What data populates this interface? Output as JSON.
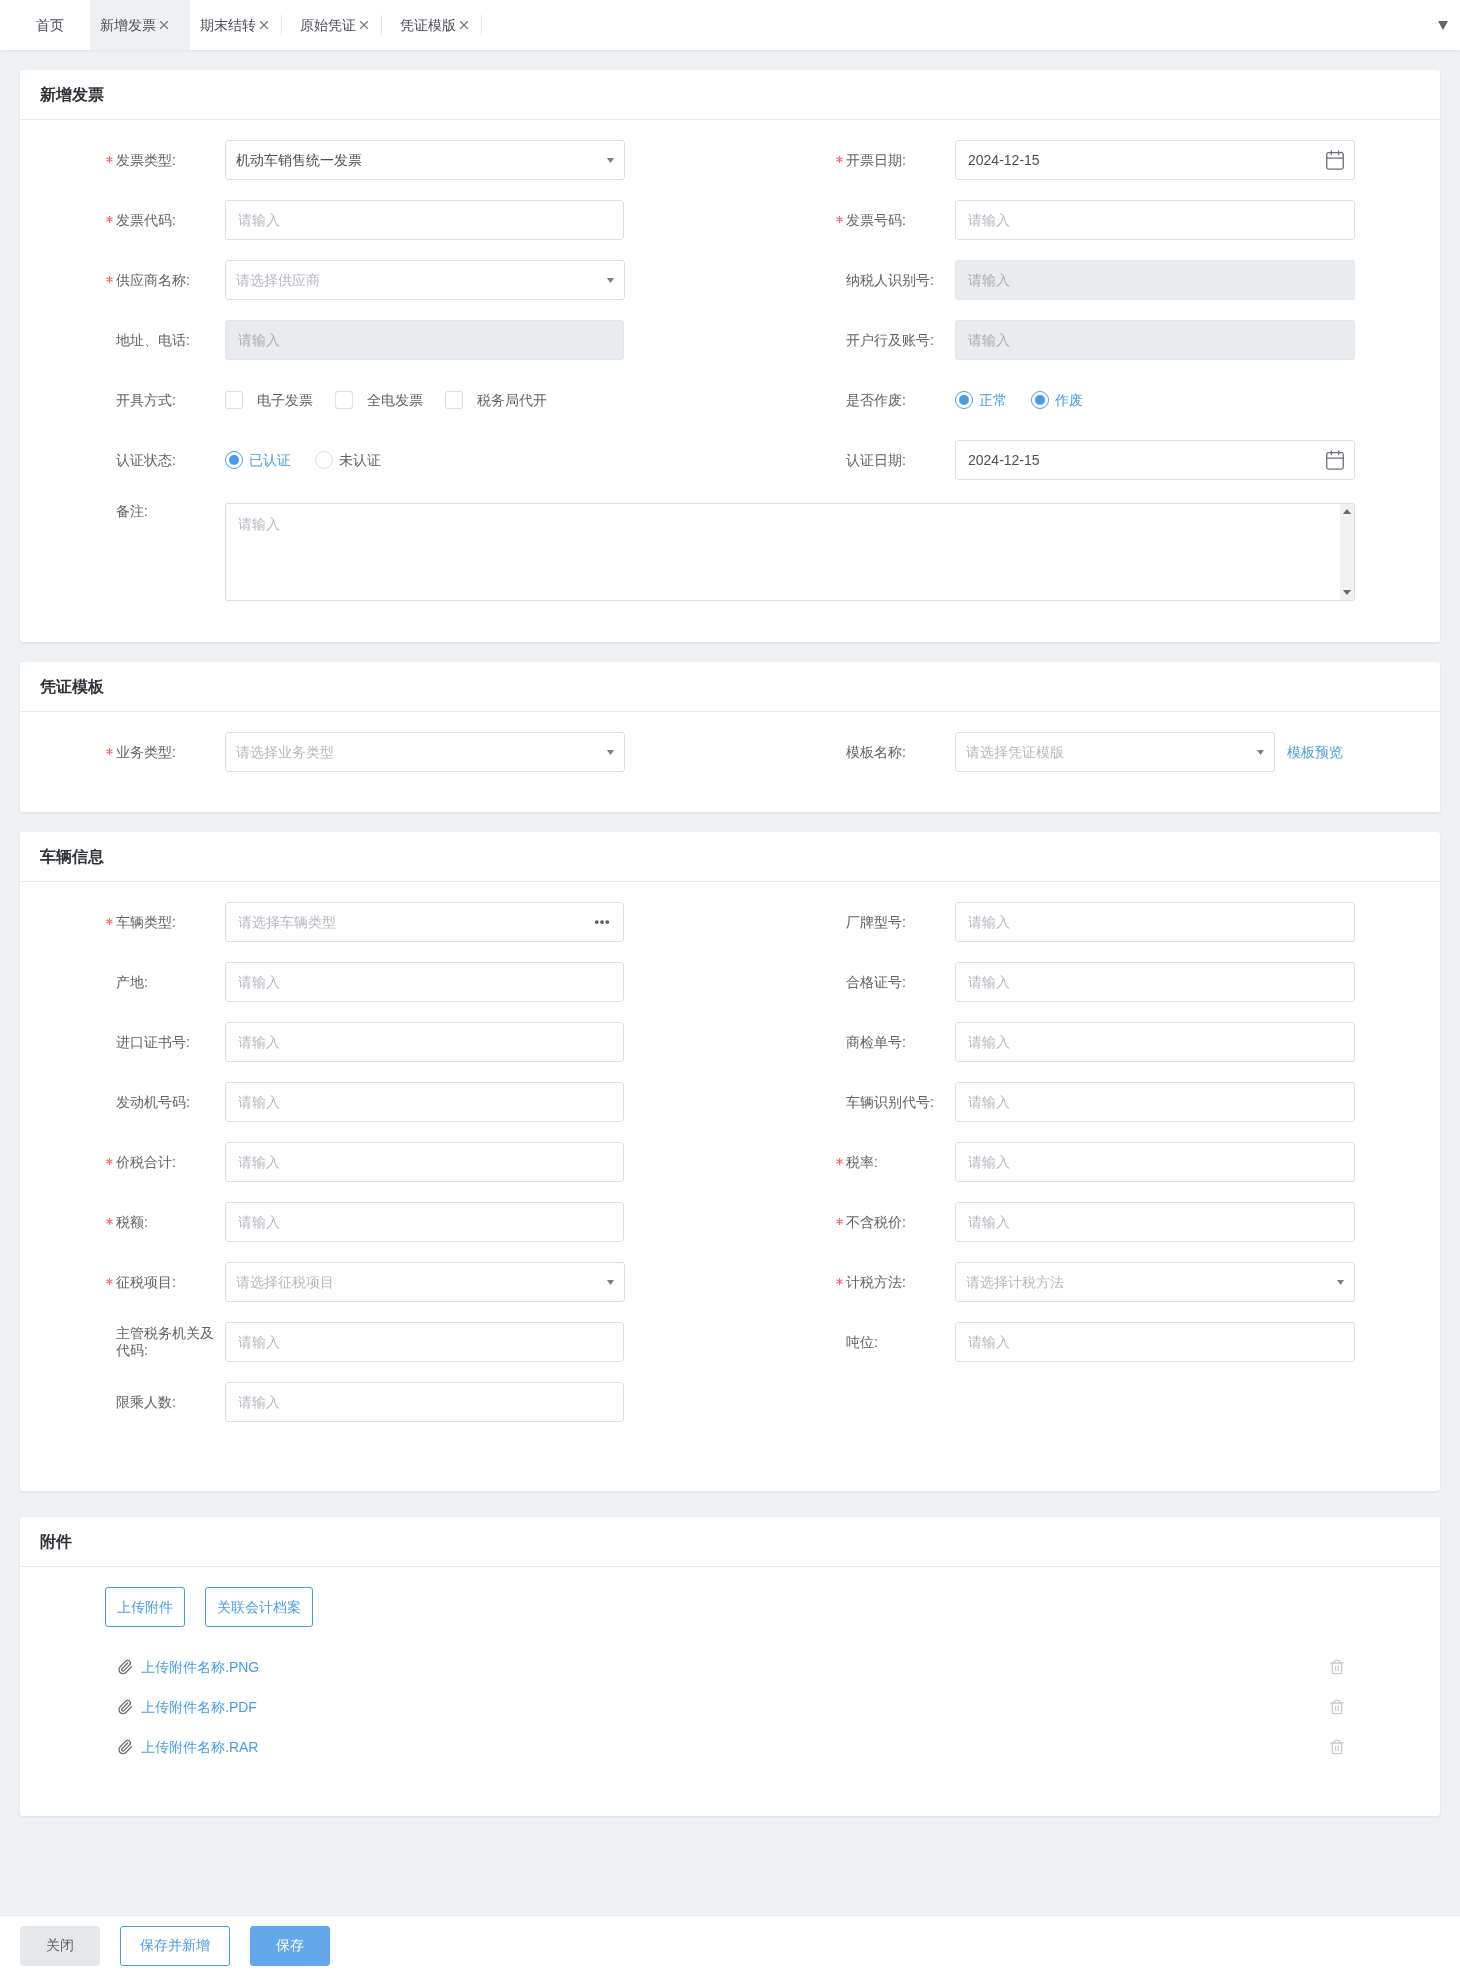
{
  "tabs": [
    {
      "label": "首页",
      "closable": false,
      "selected": false
    },
    {
      "label": "新增发票",
      "closable": true,
      "selected": true
    },
    {
      "label": "期末结转",
      "closable": true,
      "selected": false
    },
    {
      "label": "原始凭证",
      "closable": true,
      "selected": false
    },
    {
      "label": "凭证模版",
      "closable": true,
      "selected": false
    }
  ],
  "sections": [
    {
      "title": "新增发票",
      "fields": [
        {
          "label": "发票类型:",
          "required": true,
          "kind": "select",
          "value": "机动车销售统一发票"
        },
        {
          "label": "开票日期:",
          "required": true,
          "kind": "date",
          "value": "2024-12-15"
        },
        {
          "label": "发票代码:",
          "required": true,
          "kind": "input",
          "placeholder": "请输入",
          "disabled": false
        },
        {
          "label": "发票号码:",
          "required": true,
          "kind": "input",
          "placeholder": "请输入",
          "disabled": false
        },
        {
          "label": "供应商名称:",
          "required": true,
          "kind": "select",
          "placeholder": "请选择供应商"
        },
        {
          "label": "纳税人识别号:",
          "required": false,
          "kind": "input",
          "placeholder": "请输入",
          "disabled": true
        },
        {
          "label": "地址、电话:",
          "required": false,
          "kind": "input",
          "placeholder": "请输入",
          "disabled": true
        },
        {
          "label": "开户行及账号:",
          "required": false,
          "kind": "input",
          "placeholder": "请输入",
          "disabled": true
        },
        {
          "label": "开具方式:",
          "required": false,
          "kind": "checkbox_group",
          "options": [
            {
              "label": "电子发票",
              "checked": false
            },
            {
              "label": "全电发票",
              "checked": false
            },
            {
              "label": "税务局代开",
              "checked": false
            }
          ]
        },
        {
          "label": "是否作废:",
          "required": false,
          "kind": "radio_group",
          "options": [
            {
              "label": "正常",
              "selected": true
            },
            {
              "label": "作废",
              "selected": true
            }
          ]
        },
        {
          "label": "认证状态:",
          "required": false,
          "kind": "radio_group",
          "options": [
            {
              "label": "已认证",
              "selected": true
            },
            {
              "label": "未认证",
              "selected": false
            }
          ]
        },
        {
          "label": "认证日期:",
          "required": false,
          "kind": "date",
          "value": "2024-12-15"
        },
        {
          "label": "备注:",
          "required": false,
          "kind": "textarea",
          "placeholder": "请输入"
        }
      ]
    },
    {
      "title": "凭证模板",
      "fields": [
        {
          "label": "业务类型:",
          "required": true,
          "kind": "select",
          "placeholder": "请选择业务类型"
        },
        {
          "label": "模板名称:",
          "required": false,
          "kind": "select",
          "placeholder": "请选择凭证模版",
          "link": "模板预览"
        }
      ]
    },
    {
      "title": "车辆信息",
      "fields": [
        {
          "label": "车辆类型:",
          "required": true,
          "kind": "picker",
          "placeholder": "请选择车辆类型"
        },
        {
          "label": "厂牌型号:",
          "required": false,
          "kind": "input",
          "placeholder": "请输入",
          "disabled": false
        },
        {
          "label": "产地:",
          "required": false,
          "kind": "input",
          "placeholder": "请输入",
          "disabled": false
        },
        {
          "label": "合格证号:",
          "required": false,
          "kind": "input",
          "placeholder": "请输入",
          "disabled": false
        },
        {
          "label": "进口证书号:",
          "required": false,
          "kind": "input",
          "placeholder": "请输入",
          "disabled": false
        },
        {
          "label": "商检单号:",
          "required": false,
          "kind": "input",
          "placeholder": "请输入",
          "disabled": false
        },
        {
          "label": "发动机号码:",
          "required": false,
          "kind": "input",
          "placeholder": "请输入",
          "disabled": false
        },
        {
          "label": "车辆识别代号:",
          "required": false,
          "kind": "input",
          "placeholder": "请输入",
          "disabled": false
        },
        {
          "label": "价税合计:",
          "required": true,
          "kind": "input",
          "placeholder": "请输入",
          "disabled": false
        },
        {
          "label": "税率:",
          "required": true,
          "kind": "input",
          "placeholder": "请输入",
          "disabled": false
        },
        {
          "label": "税额:",
          "required": true,
          "kind": "input",
          "placeholder": "请输入",
          "disabled": false
        },
        {
          "label": "不含税价:",
          "required": true,
          "kind": "input",
          "placeholder": "请输入",
          "disabled": false
        },
        {
          "label": "征税项目:",
          "required": true,
          "kind": "select",
          "placeholder": "请选择征税项目"
        },
        {
          "label": "计税方法:",
          "required": true,
          "kind": "select",
          "placeholder": "请选择计税方法"
        },
        {
          "label": "主管税务机关及代码:",
          "required": false,
          "kind": "input",
          "placeholder": "请输入",
          "disabled": false
        },
        {
          "label": "吨位:",
          "required": false,
          "kind": "input",
          "placeholder": "请输入",
          "disabled": false
        },
        {
          "label": "限乘人数:",
          "required": false,
          "kind": "input",
          "placeholder": "请输入",
          "disabled": false
        }
      ]
    }
  ],
  "attachments": {
    "title": "附件",
    "buttons": [
      "上传附件",
      "关联会计档案"
    ],
    "files": [
      {
        "name": "上传附件名称.PNG"
      },
      {
        "name": "上传附件名称.PDF"
      },
      {
        "name": "上传附件名称.RAR"
      }
    ]
  },
  "footer": {
    "buttons": [
      {
        "label": "关闭",
        "kind": "default"
      },
      {
        "label": "保存并新增",
        "kind": "outline"
      },
      {
        "label": "保存",
        "kind": "primary"
      }
    ]
  }
}
